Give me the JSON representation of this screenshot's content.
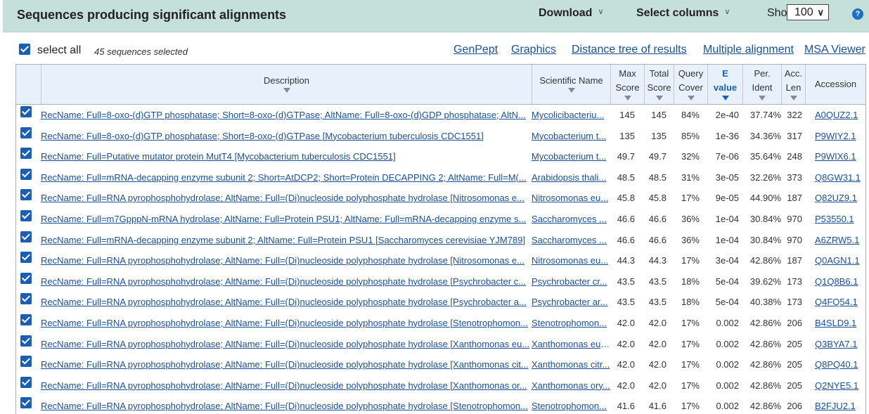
{
  "header": {
    "title": "Sequences producing significant alignments",
    "download_label": "Download",
    "select_columns_label": "Select columns",
    "show_label": "Show",
    "show_value": "100",
    "help_glyph": "?"
  },
  "selection": {
    "select_all_label": "select all",
    "selected_count_text": "45 sequences selected",
    "links": [
      "GenPept",
      "Graphics",
      "Distance tree of results",
      "Multiple alignment",
      "MSA Viewer"
    ]
  },
  "table": {
    "columns": {
      "description": "Description",
      "scientific_name": "Scientific Name",
      "max_score": [
        "Max",
        "Score"
      ],
      "total_score": [
        "Total",
        "Score"
      ],
      "query_cover": [
        "Query",
        "Cover"
      ],
      "e_value": [
        "E",
        "value"
      ],
      "per_ident": [
        "Per.",
        "Ident"
      ],
      "acc_len": [
        "Acc.",
        "Len"
      ],
      "accession": "Accession"
    },
    "rows": [
      {
        "description": "RecName: Full=8-oxo-(d)GTP phosphatase; Short=8-oxo-(d)GTPase; AltName: Full=8-oxo-(d)GDP phosphatase; AltN...",
        "scientific_name": "Mycolicibacteriu...",
        "max_score": "145",
        "total_score": "145",
        "query_cover": "84%",
        "e_value": "2e-40",
        "per_ident": "37.74%",
        "acc_len": "322",
        "accession": "A0QUZ2.1"
      },
      {
        "description": "RecName: Full=8-oxo-(d)GTP phosphatase; Short=8-oxo-(d)GTPase [Mycobacterium tuberculosis CDC1551]",
        "scientific_name": "Mycobacterium t...",
        "max_score": "135",
        "total_score": "135",
        "query_cover": "85%",
        "e_value": "1e-36",
        "per_ident": "34.36%",
        "acc_len": "317",
        "accession": "P9WIY2.1"
      },
      {
        "description": "RecName: Full=Putative mutator protein MutT4 [Mycobacterium tuberculosis CDC1551]",
        "scientific_name": "Mycobacterium t...",
        "max_score": "49.7",
        "total_score": "49.7",
        "query_cover": "32%",
        "e_value": "7e-06",
        "per_ident": "35.64%",
        "acc_len": "248",
        "accession": "P9WIX6.1"
      },
      {
        "description": "RecName: Full=mRNA-decapping enzyme subunit 2; Short=AtDCP2; Short=Protein DECAPPING 2; AltName: Full=M(...",
        "scientific_name": "Arabidopsis thali...",
        "max_score": "48.5",
        "total_score": "48.5",
        "query_cover": "31%",
        "e_value": "3e-05",
        "per_ident": "32.26%",
        "acc_len": "373",
        "accession": "Q8GW31.1"
      },
      {
        "description": "RecName: Full=RNA pyrophosphohydrolase; AltName: Full=(Di)nucleoside polyphosphate hydrolase [Nitrosomonas e...",
        "scientific_name": "Nitrosomonas eu...",
        "max_score": "45.8",
        "total_score": "45.8",
        "query_cover": "17%",
        "e_value": "9e-05",
        "per_ident": "44.90%",
        "acc_len": "187",
        "accession": "Q82UZ9.1"
      },
      {
        "description": "RecName: Full=m7GpppN-mRNA hydrolase; AltName: Full=Protein PSU1; AltName: Full=mRNA-decapping enzyme s...",
        "scientific_name": "Saccharomyces ...",
        "max_score": "46.6",
        "total_score": "46.6",
        "query_cover": "36%",
        "e_value": "1e-04",
        "per_ident": "30.84%",
        "acc_len": "970",
        "accession": "P53550.1"
      },
      {
        "description": "RecName: Full=mRNA-decapping enzyme subunit 2; AltName: Full=Protein PSU1 [Saccharomyces cerevisiae YJM789]",
        "scientific_name": "Saccharomyces ...",
        "max_score": "46.6",
        "total_score": "46.6",
        "query_cover": "36%",
        "e_value": "1e-04",
        "per_ident": "30.84%",
        "acc_len": "970",
        "accession": "A6ZRW5.1"
      },
      {
        "description": "RecName: Full=RNA pyrophosphohydrolase; AltName: Full=(Di)nucleoside polyphosphate hydrolase [Nitrosomonas e...",
        "scientific_name": "Nitrosomonas eu...",
        "max_score": "44.3",
        "total_score": "44.3",
        "query_cover": "17%",
        "e_value": "3e-04",
        "per_ident": "42.86%",
        "acc_len": "187",
        "accession": "Q0AGN1.1"
      },
      {
        "description": "RecName: Full=RNA pyrophosphohydrolase; AltName: Full=(Di)nucleoside polyphosphate hydrolase [Psychrobacter c...",
        "scientific_name": "Psychrobacter cr...",
        "max_score": "43.5",
        "total_score": "43.5",
        "query_cover": "18%",
        "e_value": "5e-04",
        "per_ident": "39.62%",
        "acc_len": "173",
        "accession": "Q1Q8B6.1"
      },
      {
        "description": "RecName: Full=RNA pyrophosphohydrolase; AltName: Full=(Di)nucleoside polyphosphate hydrolase [Psychrobacter a...",
        "scientific_name": "Psychrobacter ar...",
        "max_score": "43.5",
        "total_score": "43.5",
        "query_cover": "18%",
        "e_value": "5e-04",
        "per_ident": "40.38%",
        "acc_len": "173",
        "accession": "Q4FQ54.1"
      },
      {
        "description": "RecName: Full=RNA pyrophosphohydrolase; AltName: Full=(Di)nucleoside polyphosphate hydrolase [Stenotrophomon...",
        "scientific_name": "Stenotrophomon...",
        "max_score": "42.0",
        "total_score": "42.0",
        "query_cover": "17%",
        "e_value": "0.002",
        "per_ident": "42.86%",
        "acc_len": "206",
        "accession": "B4SLD9.1"
      },
      {
        "description": "RecName: Full=RNA pyrophosphohydrolase; AltName: Full=(Di)nucleoside polyphosphate hydrolase [Xanthomonas eu...",
        "scientific_name": "Xanthomonas euv...",
        "max_score": "42.0",
        "total_score": "42.0",
        "query_cover": "17%",
        "e_value": "0.002",
        "per_ident": "42.86%",
        "acc_len": "205",
        "accession": "Q3BYA7.1"
      },
      {
        "description": "RecName: Full=RNA pyrophosphohydrolase; AltName: Full=(Di)nucleoside polyphosphate hydrolase [Xanthomonas cit...",
        "scientific_name": "Xanthomonas citr...",
        "max_score": "42.0",
        "total_score": "42.0",
        "query_cover": "17%",
        "e_value": "0.002",
        "per_ident": "42.86%",
        "acc_len": "205",
        "accession": "Q8PQ40.1"
      },
      {
        "description": "RecName: Full=RNA pyrophosphohydrolase; AltName: Full=(Di)nucleoside polyphosphate hydrolase [Xanthomonas or...",
        "scientific_name": "Xanthomonas ory...",
        "max_score": "42.0",
        "total_score": "42.0",
        "query_cover": "17%",
        "e_value": "0.002",
        "per_ident": "42.86%",
        "acc_len": "205",
        "accession": "Q2NYE5.1"
      },
      {
        "description": "RecName: Full=RNA pyrophosphohydrolase; AltName: Full=(Di)nucleoside polyphosphate hydrolase [Stenotrophomon...",
        "scientific_name": "Stenotrophomon...",
        "max_score": "41.6",
        "total_score": "41.6",
        "query_cover": "17%",
        "e_value": "0.002",
        "per_ident": "42.86%",
        "acc_len": "206",
        "accession": "B2FJU2.1"
      }
    ]
  }
}
